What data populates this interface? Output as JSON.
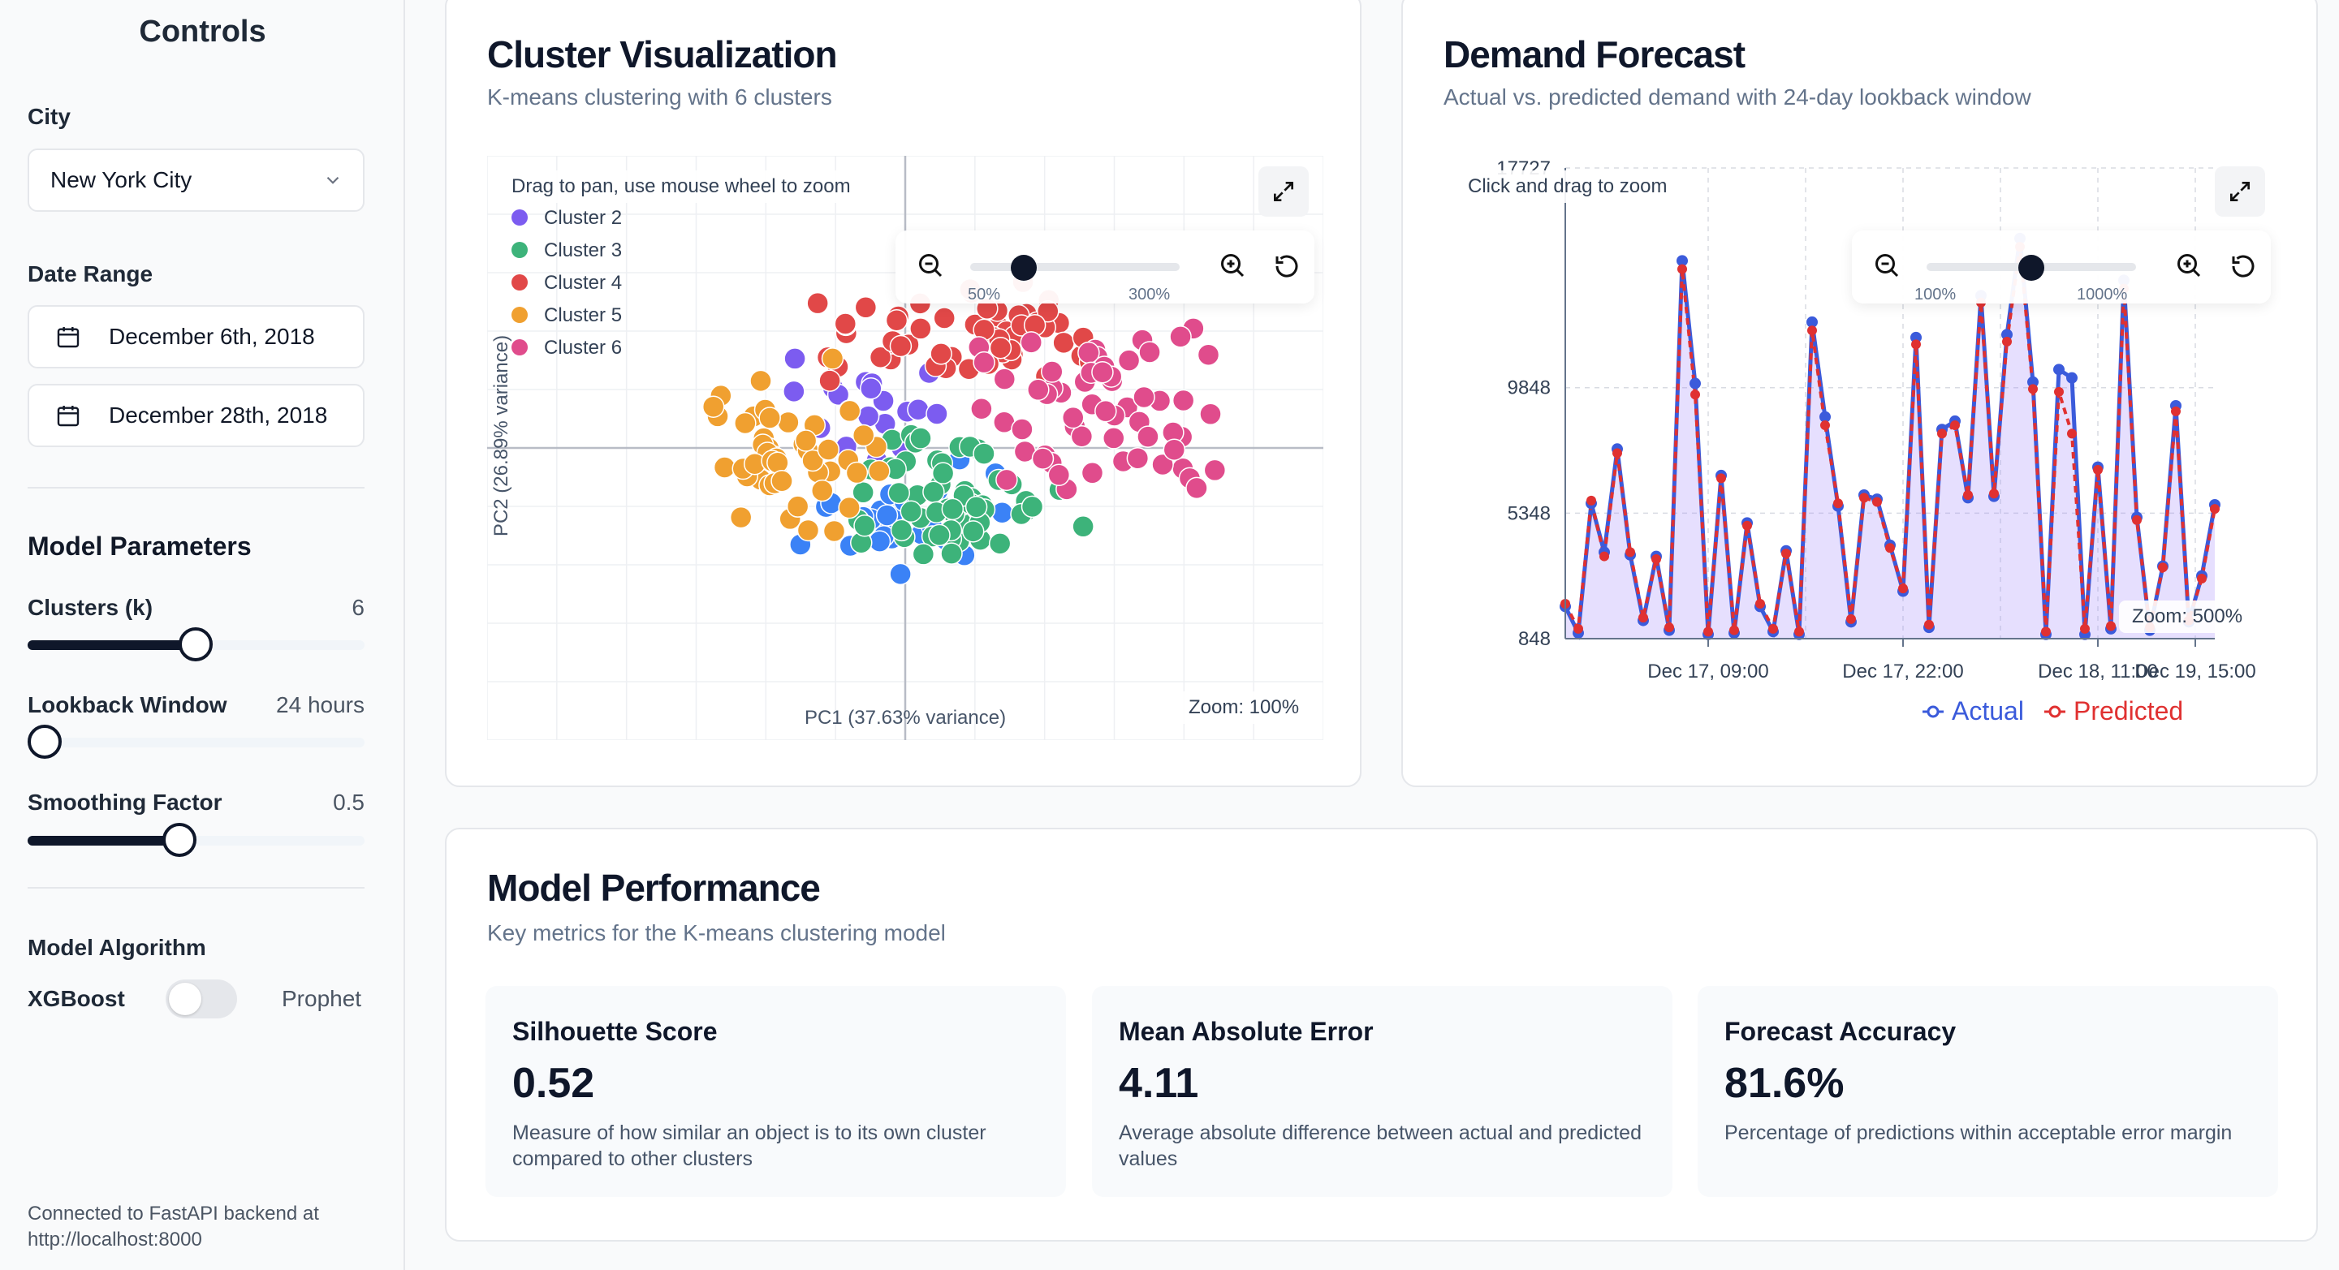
{
  "sidebar": {
    "title": "Controls",
    "city_label": "City",
    "city_value": "New York City",
    "date_range_label": "Date Range",
    "start_date": "December 6th, 2018",
    "end_date": "December 28th, 2018",
    "model_params_title": "Model Parameters",
    "clusters": {
      "label": "Clusters (k)",
      "value": "6",
      "fraction": 0.5
    },
    "lookback": {
      "label": "Lookback Window",
      "value": "24 hours",
      "fraction": 0.0
    },
    "smoothing": {
      "label": "Smoothing Factor",
      "value": "0.5",
      "fraction": 0.45
    },
    "algorithm_title": "Model Algorithm",
    "algo_left": "XGBoost",
    "algo_right": "Prophet",
    "connection_note": "Connected to FastAPI backend at http://localhost:8000"
  },
  "cluster_card": {
    "title": "Cluster Visualization",
    "subtitle": "K-means clustering with 6 clusters",
    "hint": "Drag to pan, use mouse wheel to zoom",
    "zoom_min_label": "50%",
    "zoom_max_label": "300%",
    "zoom_fraction": 0.2,
    "zoom_status": "Zoom: 100%",
    "colors": [
      "#7c5cf0",
      "#3b82f6",
      "#3db37a",
      "#e14848",
      "#f0a030",
      "#e04c8c"
    ]
  },
  "forecast_card": {
    "title": "Demand Forecast",
    "subtitle": "Actual vs. predicted demand with 24-day lookback window",
    "hint": "Click and drag to zoom",
    "zoom_min_label": "100%",
    "zoom_max_label": "1000%",
    "zoom_fraction": 0.45,
    "zoom_status": "Zoom: 500%",
    "actual_color": "#3b5bdb",
    "predicted_color": "#e03131"
  },
  "performance_card": {
    "title": "Model Performance",
    "subtitle": "Key metrics for the K-means clustering model",
    "metrics": [
      {
        "title": "Silhouette Score",
        "value": "0.52",
        "desc": "Measure of how similar an object is to its own cluster compared to other clusters"
      },
      {
        "title": "Mean Absolute Error",
        "value": "4.11",
        "desc": "Average absolute difference between actual and predicted values"
      },
      {
        "title": "Forecast Accuracy",
        "value": "81.6%",
        "desc": "Percentage of predictions within acceptable error margin"
      }
    ]
  },
  "chart_data": [
    {
      "type": "scatter",
      "title": "",
      "xlabel": "PC1 (37.63% variance)",
      "ylabel": "PC2 (26.89% variance)",
      "legend": [
        "Cluster 2",
        "Cluster 3",
        "Cluster 4",
        "Cluster 5",
        "Cluster 6"
      ],
      "legend_placement": "top-left",
      "grid": true,
      "series": [
        {
          "name": "Cluster 2",
          "center": [
            -0.3,
            0.7
          ],
          "spread": [
            0.9,
            0.8
          ],
          "count": 20
        },
        {
          "name": "Cluster 3",
          "center": [
            0.8,
            -0.8
          ],
          "spread": [
            1.1,
            0.7
          ],
          "count": 60
        },
        {
          "name": "Cluster 4",
          "center": [
            1.0,
            1.9
          ],
          "spread": [
            1.4,
            0.6
          ],
          "count": 60
        },
        {
          "name": "Cluster 5",
          "center": [
            -1.6,
            0.0
          ],
          "spread": [
            0.8,
            1.0
          ],
          "count": 50
        },
        {
          "name": "Cluster 6",
          "center": [
            2.8,
            0.8
          ],
          "spread": [
            1.2,
            1.2
          ],
          "count": 60
        }
      ]
    },
    {
      "type": "line",
      "title": "",
      "xlabel": "",
      "ylabel": "",
      "x_tick_labels": [
        "Dec 17, 09:00",
        "Dec 17, 22:00",
        "Dec 18, 11:00",
        "Dec 19, 15:00"
      ],
      "y_ticks": [
        848,
        5348,
        9848,
        17727
      ],
      "ylim": [
        848,
        17727
      ],
      "legend": [
        "Actual",
        "Predicted"
      ],
      "legend_placement": "bottom-center",
      "series": [
        {
          "name": "Actual",
          "values": [
            2000,
            1050,
            5700,
            3950,
            7650,
            3850,
            1500,
            3800,
            1150,
            14400,
            10000,
            1000,
            6700,
            1050,
            5000,
            2000,
            1100,
            4000,
            1000,
            12200,
            8800,
            5600,
            1450,
            6000,
            5850,
            4200,
            2550,
            11650,
            1250,
            8350,
            8650,
            5900,
            13150,
            5950,
            11750,
            15200,
            10050,
            1000,
            10500,
            10200,
            1000,
            7000,
            1200,
            13700,
            5200,
            1150,
            3450,
            9200,
            1450,
            3100,
            5650
          ]
        },
        {
          "name": "Predicted",
          "values": [
            2100,
            1200,
            5800,
            3800,
            7500,
            3950,
            1600,
            3700,
            1250,
            14100,
            9600,
            1100,
            6600,
            1150,
            4900,
            2100,
            1200,
            3900,
            1100,
            11900,
            8500,
            5700,
            1550,
            5900,
            5750,
            4100,
            2650,
            11400,
            1350,
            8200,
            8500,
            6000,
            12900,
            6050,
            11500,
            14900,
            9800,
            1100,
            9700,
            8200,
            1200,
            6900,
            1300,
            13400,
            5100,
            1250,
            3400,
            9000,
            1500,
            3000,
            5500
          ]
        }
      ]
    }
  ]
}
